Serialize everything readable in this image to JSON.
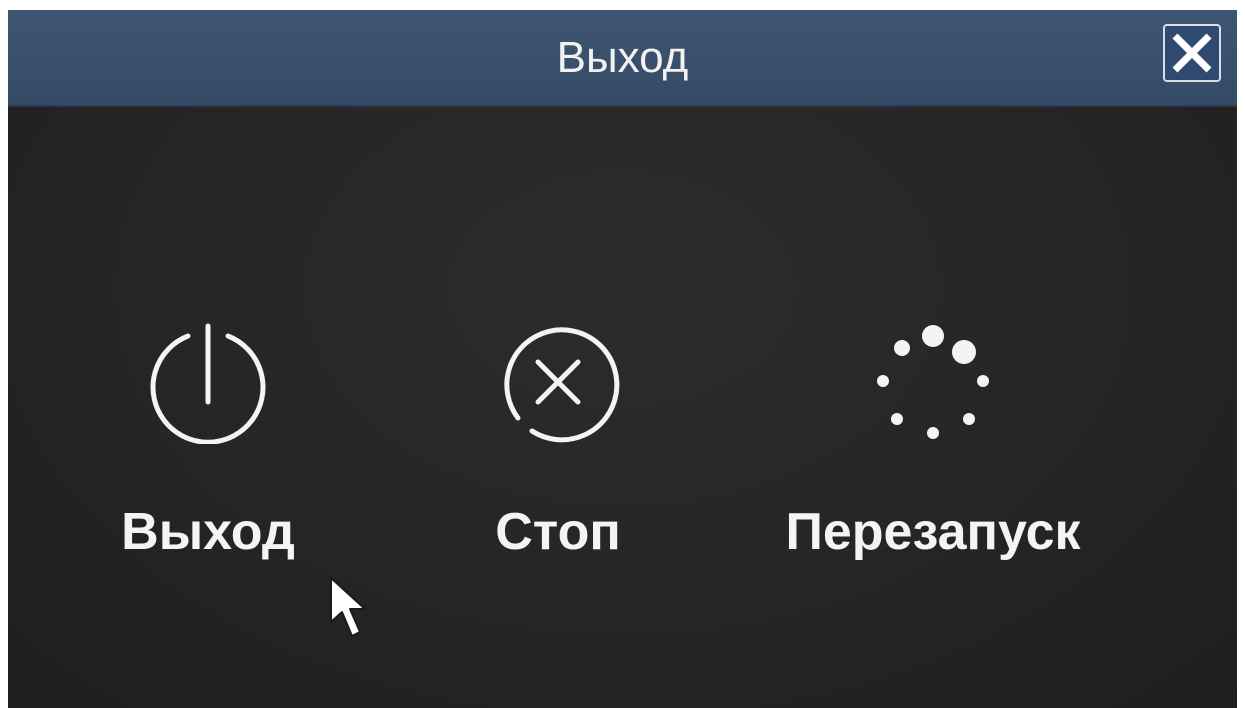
{
  "dialog": {
    "title": "Выход",
    "close_icon": "close-icon"
  },
  "actions": [
    {
      "label": "Выход",
      "icon": "power-icon"
    },
    {
      "label": "Стоп",
      "icon": "stop-circle-x-icon"
    },
    {
      "label": "Перезапуск",
      "icon": "restart-dots-icon"
    }
  ],
  "colors": {
    "titlebar": "#3a5170",
    "background": "#262524",
    "text": "#f4f4f4",
    "close_button": "#2f4a6e"
  }
}
